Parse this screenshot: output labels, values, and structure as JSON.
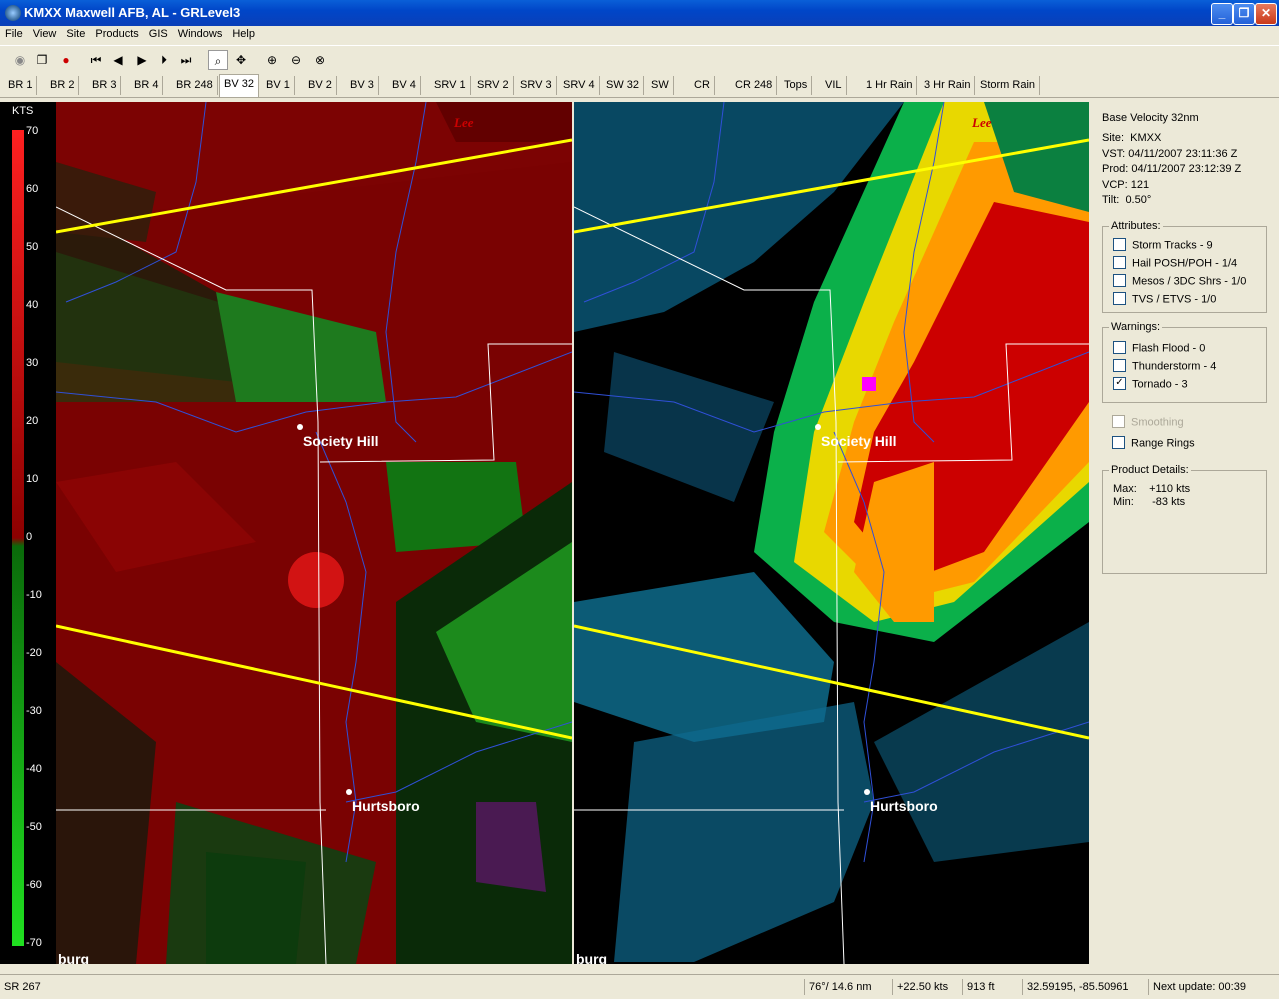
{
  "window": {
    "title": "KMXX Maxwell AFB, AL - GRLevel3",
    "min": "_",
    "max": "❐",
    "close": "✕"
  },
  "menu": [
    "File",
    "View",
    "Site",
    "Products",
    "GIS",
    "Windows",
    "Help"
  ],
  "toolbar": {
    "icons": [
      "globe-icon",
      "copy-icon",
      "record-icon",
      "first-frame-icon",
      "prev-frame-icon",
      "play-icon",
      "next-frame-icon",
      "last-frame-icon",
      "zoom-select-icon",
      "pan-icon",
      "zoom-in-icon",
      "zoom-out-icon",
      "zoom-reset-icon"
    ]
  },
  "tabs": [
    "BR 1",
    "BR 2",
    "BR 3",
    "BR 4",
    "BR 248",
    "BV 32",
    "BV 1",
    "BV 2",
    "BV 3",
    "BV 4",
    "SRV 1",
    "SRV 2",
    "SRV 3",
    "SRV 4",
    "SW 32",
    "SW",
    "CR",
    "CR 248",
    "Tops",
    "VIL",
    "1 Hr Rain",
    "3 Hr Rain",
    "Storm Rain"
  ],
  "active_tab": "BV 32",
  "colorbar": {
    "unit": "KTS",
    "ticks": [
      "70",
      "60",
      "50",
      "40",
      "30",
      "20",
      "10",
      "0",
      "-10",
      "-20",
      "-30",
      "-40",
      "-50",
      "-60",
      "-70"
    ]
  },
  "map": {
    "cities": [
      "Society Hill",
      "Hurtsboro"
    ],
    "county": "Lee",
    "edge_text": "burg"
  },
  "sidebar": {
    "product": "Base Velocity 32nm",
    "site_label": "Site:",
    "site": "KMXX",
    "vst_label": "VST:",
    "vst": "04/11/2007  23:11:36 Z",
    "prod_label": "Prod:",
    "prod": "04/11/2007  23:12:39 Z",
    "vcp_label": "VCP:",
    "vcp": "121",
    "tilt_label": "Tilt:",
    "tilt": "0.50°",
    "attributes_title": "Attributes:",
    "attributes": [
      {
        "label": "Storm Tracks - 9",
        "checked": false
      },
      {
        "label": "Hail POSH/POH - 1/4",
        "checked": false
      },
      {
        "label": "Mesos / 3DC Shrs - 1/0",
        "checked": false
      },
      {
        "label": "TVS / ETVS - 1/0",
        "checked": false
      }
    ],
    "warnings_title": "Warnings:",
    "warnings": [
      {
        "label": "Flash Flood - 0",
        "checked": false
      },
      {
        "label": "Thunderstorm - 4",
        "checked": false
      },
      {
        "label": "Tornado - 3",
        "checked": true
      }
    ],
    "smoothing": "Smoothing",
    "range_rings": "Range Rings",
    "details_title": "Product Details:",
    "max_label": "Max:",
    "max": "+110 kts",
    "min_label": "Min:",
    "min": "-83 kts"
  },
  "status": {
    "product": "SR 267",
    "azimuth": "76°/ 14.6 nm",
    "value": "+22.50 kts",
    "height": "913 ft",
    "latlon": "32.59195, -85.50961",
    "next_update": "Next update: 00:39"
  }
}
